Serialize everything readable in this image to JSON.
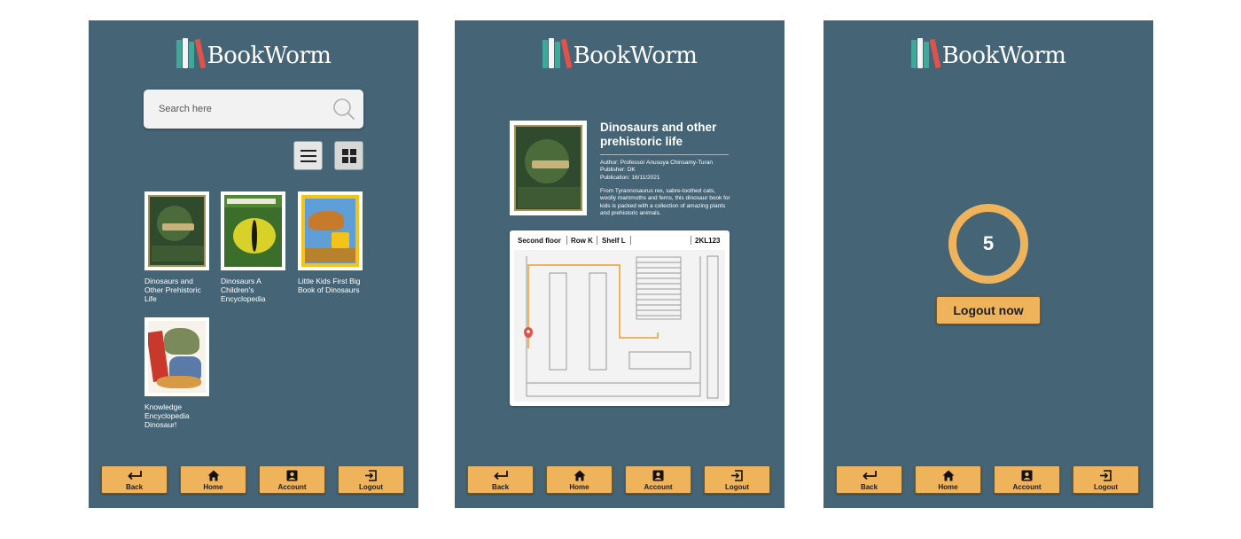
{
  "app": {
    "name": "BookWorm"
  },
  "colors": {
    "panel": "#456577",
    "accent": "#efb45b",
    "logo_teal": "#3ea899",
    "logo_white": "#f4f4f4",
    "logo_red": "#e0524a"
  },
  "search_screen": {
    "search_placeholder": "Search here",
    "list_view_icon": "list-icon",
    "grid_view_icon": "grid-icon",
    "books": [
      {
        "title": "Dinosaurs and Other Prehistoric Life"
      },
      {
        "title": "Dinosaurs A Children's Encyclopedia"
      },
      {
        "title": "Little Kids First Big Book of Dinosaurs"
      },
      {
        "title": "Knowledge Encyclopedia Dinosaur!"
      }
    ]
  },
  "detail_screen": {
    "title": "Dinosaurs and other prehistoric life",
    "author": "Author: Professor Anusuya Chinsamy-Turan",
    "publisher": "Publisher: DK",
    "publication": "Publication: 16/11/2021",
    "description": "From Tyrannosaurus rex, sabre-toothed cats, woolly mammoths and ferns, this dinosaur book for kids is packed with a collection of amazing plants and prehistoric animals.",
    "location": {
      "floor": "Second floor",
      "row": "Row K",
      "shelf": "Shelf L",
      "code": "2KL123"
    }
  },
  "logout_screen": {
    "countdown": "5",
    "logout_now_label": "Logout now"
  },
  "nav": {
    "back": "Back",
    "home": "Home",
    "account": "Account",
    "logout": "Logout"
  }
}
